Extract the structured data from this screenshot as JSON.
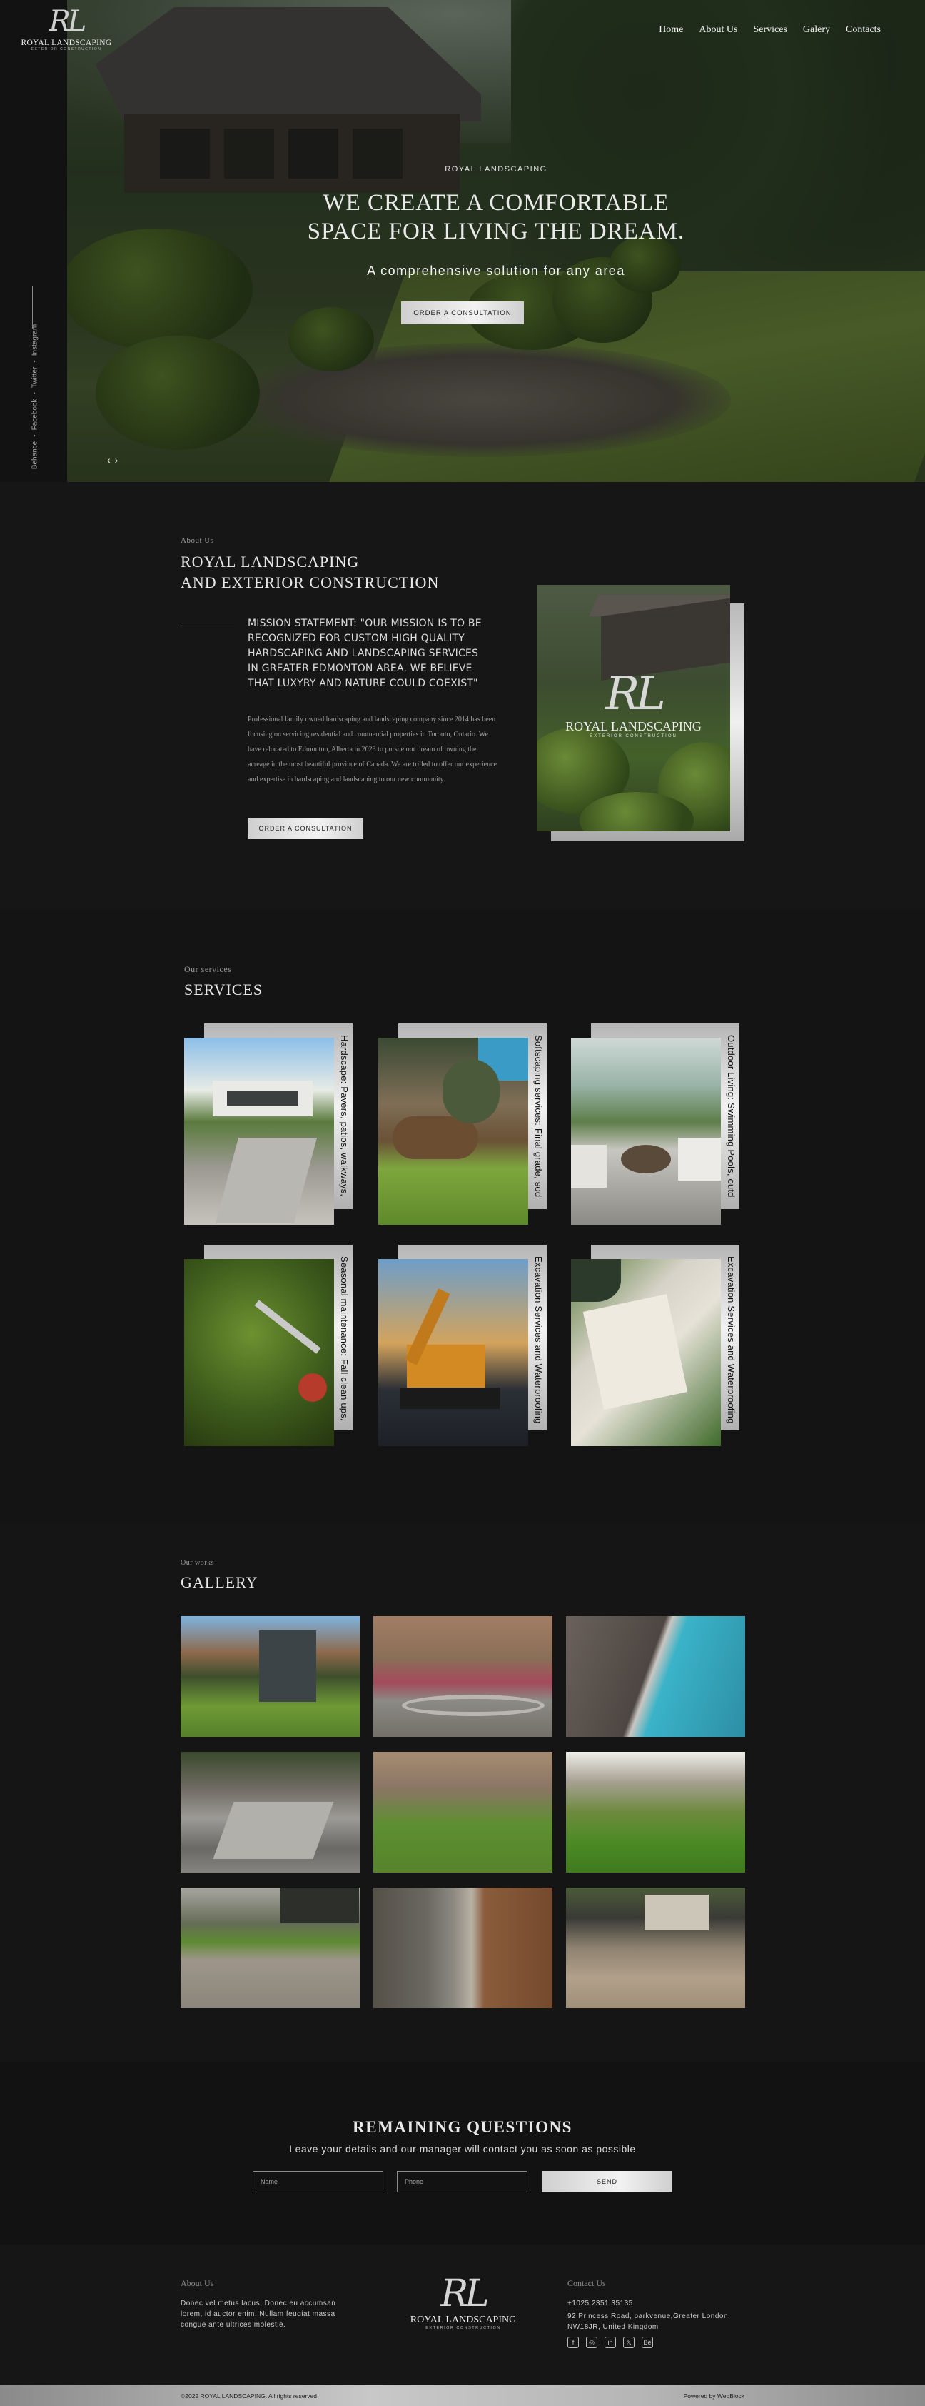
{
  "brand": {
    "monogram": "RL",
    "name": "ROYAL LANDSCAPING",
    "tagline": "EXTERIOR CONSTRUCTION"
  },
  "nav": [
    "Home",
    "About Us",
    "Services",
    "Galery",
    "Contacts"
  ],
  "hero": {
    "eyebrow": "ROYAL LANDSCAPING",
    "title_line1": "WE CREATE A COMFORTABLE",
    "title_line2": "SPACE FOR LIVING THE DREAM.",
    "subtitle": "A comprehensive solution for any area",
    "cta": "ORDER A CONSULTATION",
    "social": [
      "Behance",
      "Facebook",
      "Twitter",
      "Instagram"
    ],
    "social_separator": "-",
    "prev": "‹",
    "next": "›"
  },
  "about": {
    "eyebrow": "About Us",
    "title_line1": "ROYAL LANDSCAPING",
    "title_line2": "AND EXTERIOR CONSTRUCTION",
    "mission": "MISSION STATEMENT: \"OUR MISSION IS TO BE RECOGNIZED FOR CUSTOM HIGH QUALITY HARDSCAPING AND LANDSCAPING SERVICES IN GREATER EDMONTON AREA.  WE BELIEVE THAT LUXYRY AND NATURE COULD COEXIST\"",
    "body": "Professional family owned hardscaping and landscaping company since 2014 has been focusing  on servicing residential and commercial properties in Toronto, Ontario.  We have relocated to Edmonton, Alberta in 2023 to pursue our dream of owning the acreage in the most beautiful province of Canada.  We are trilled to offer our experience and expertise in hardscaping and landscaping to our new community.",
    "cta": "ORDER A CONSULTATION"
  },
  "services": {
    "eyebrow": "Our services",
    "title": "SERVICES",
    "items": [
      {
        "caption": "Hardscape: Pavers, patios, walkways,"
      },
      {
        "caption": "Softscaping services: Final grade, sod"
      },
      {
        "caption": "Outdoor Living:  Swimming Pools, outd"
      },
      {
        "caption": "Seasonal maintenance: Fall clean ups,"
      },
      {
        "caption": "Excavation Services and Waterproofing"
      },
      {
        "caption": "Excavation Services and Waterproofing"
      }
    ]
  },
  "gallery": {
    "eyebrow": "Our works",
    "title": "GALLERY"
  },
  "questions": {
    "title": "REMAINING QUESTIONS",
    "subtitle": "Leave your details and our manager will contact you as soon as possible",
    "name_placeholder": "Name",
    "phone_placeholder": "Phone",
    "send": "SEND"
  },
  "footer": {
    "about_head": "About Us",
    "about_text": "Donec vel metus lacus. Donec eu accumsan lorem, id auctor enim. Nullam feugiat massa congue ante ultrices molestie.",
    "contact_head": "Contact Us",
    "phone": "+1025 2351 35135",
    "address": "92 Princess Road, parkvenue,Greater London, NW18JR, United Kingdom",
    "icons": [
      "f",
      "◎",
      "in",
      "𝕏",
      "Bē"
    ],
    "copyright": "©2022 ROYAL LANDSCAPING. All rights reserved",
    "powered": "Powered by WebBlock"
  }
}
